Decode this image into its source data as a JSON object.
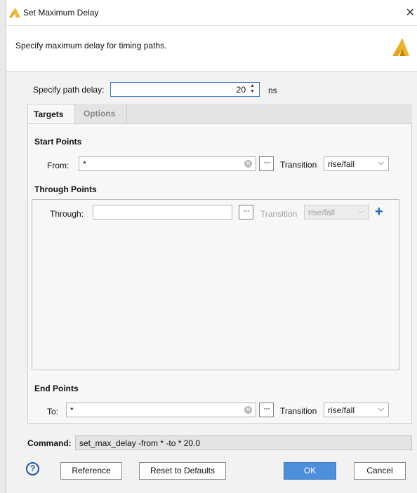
{
  "window": {
    "title": "Set Maximum Delay"
  },
  "header": {
    "description": "Specify maximum delay for timing paths."
  },
  "path_delay": {
    "label": "Specify path delay:",
    "value": "20",
    "unit": "ns"
  },
  "tabs": [
    {
      "label": "Targets",
      "active": true
    },
    {
      "label": "Options",
      "active": false
    }
  ],
  "start_points": {
    "title": "Start Points",
    "from_label": "From:",
    "from_value": "*",
    "transition_label": "Transition",
    "transition_value": "rise/fall"
  },
  "through_points": {
    "title": "Through Points",
    "through_label": "Through:",
    "through_value": "",
    "transition_label": "Transition",
    "transition_value": "rise/fall"
  },
  "end_points": {
    "title": "End Points",
    "to_label": "To:",
    "to_value": "*",
    "transition_label": "Transition",
    "transition_value": "rise/fall"
  },
  "command": {
    "label": "Command:",
    "value": "set_max_delay -from * -to * 20.0"
  },
  "buttons": {
    "help": "?",
    "reference": "Reference",
    "reset": "Reset to Defaults",
    "ok": "OK",
    "cancel": "Cancel"
  },
  "icons": {
    "dots": "···",
    "chevron": "⌵",
    "close": "✕",
    "clear": "✕",
    "plus": "+"
  },
  "colors": {
    "accent": "#4e8fdc",
    "brand": "#e8a317",
    "brand_dark": "#b8860b",
    "focus_border": "#3c7ac7"
  }
}
